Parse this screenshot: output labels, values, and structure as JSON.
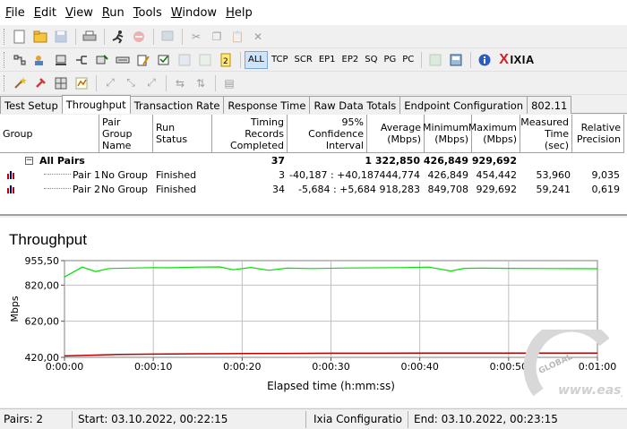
{
  "menu": [
    "File",
    "Edit",
    "View",
    "Run",
    "Tools",
    "Window",
    "Help"
  ],
  "menu_accel": [
    "F",
    "E",
    "V",
    "R",
    "T",
    "W",
    "H"
  ],
  "toolbar_protocols": [
    "ALL",
    "TCP",
    "SCR",
    "EP1",
    "EP2",
    "SQ",
    "PG",
    "PC"
  ],
  "brand": {
    "name": "IXIA",
    "x": "X",
    "accent": "#d0202a"
  },
  "tabs": [
    "Test Setup",
    "Throughput",
    "Transaction Rate",
    "Response Time",
    "Raw Data Totals",
    "Endpoint Configuration",
    "802.11"
  ],
  "active_tab": "Throughput",
  "grid": {
    "headers": [
      "Group",
      "Pair Group\nName",
      "Run Status",
      "Timing Records\nCompleted",
      "95% Confidence\nInterval",
      "Average\n(Mbps)",
      "Minimum\n(Mbps)",
      "Maximum\n(Mbps)",
      "Measured\nTime (sec)",
      "Relative\nPrecision"
    ],
    "summary": {
      "label": "All Pairs",
      "records": "37",
      "average": "1 322,850",
      "minimum": "426,849",
      "maximum": "929,692"
    },
    "rows": [
      {
        "group": "Pair 1",
        "pg_name": "No Group",
        "status": "Finished",
        "records": "3",
        "ci": "-40,187 : +40,187",
        "average": "444,774",
        "minimum": "426,849",
        "maximum": "454,442",
        "time": "53,960",
        "precision": "9,035",
        "color": "#c00000"
      },
      {
        "group": "Pair 2",
        "pg_name": "No Group",
        "status": "Finished",
        "records": "34",
        "ci": "-5,684 : +5,684",
        "average": "918,283",
        "minimum": "849,708",
        "maximum": "929,692",
        "time": "59,241",
        "precision": "0,619",
        "color": "#00c000"
      }
    ]
  },
  "chart_data": {
    "type": "line",
    "title": "Throughput",
    "xlabel": "Elapsed time (h:mm:ss)",
    "ylabel": "Mbps",
    "x_ticks": [
      "0:00:00",
      "0:00:10",
      "0:00:20",
      "0:00:30",
      "0:00:40",
      "0:00:50",
      "0:01:00"
    ],
    "y_ticks": [
      "955,50",
      "820,00",
      "620,00",
      "420,00"
    ],
    "y_tick_values": [
      955.5,
      820,
      620,
      420
    ],
    "xlim": [
      0,
      60
    ],
    "ylim": [
      420,
      955.5
    ],
    "grid": true,
    "series": [
      {
        "color": "#00e000",
        "x": [
          0,
          2,
          3.5,
          5,
          8,
          10,
          12,
          15,
          17.5,
          19,
          21,
          23,
          25,
          28,
          32,
          38,
          41,
          43.5,
          45,
          47,
          50,
          55,
          60
        ],
        "y": [
          865,
          920,
          895,
          912,
          915,
          917,
          916,
          920,
          921,
          905,
          918,
          902,
          914,
          912,
          915,
          917,
          920,
          898,
          913,
          914,
          913,
          912,
          911
        ]
      },
      {
        "color": "#c00000",
        "x": [
          0,
          3,
          6,
          10,
          15,
          20,
          25,
          30,
          35,
          40,
          45,
          50,
          55,
          60
        ],
        "y": [
          428,
          432,
          436,
          438,
          440,
          441,
          442,
          443,
          443,
          444,
          444,
          444,
          444,
          444
        ]
      }
    ]
  },
  "status": {
    "pairs": "Pairs: 2",
    "start": "Start: 03.10.2022, 00:22:15",
    "script": "Ixia Configuratio",
    "end": "End: 03.10.2022, 00:23:15"
  },
  "watermark": {
    "text1": "GLOBAL",
    "text2": "www.easy",
    "color": "#c8c8c8"
  }
}
